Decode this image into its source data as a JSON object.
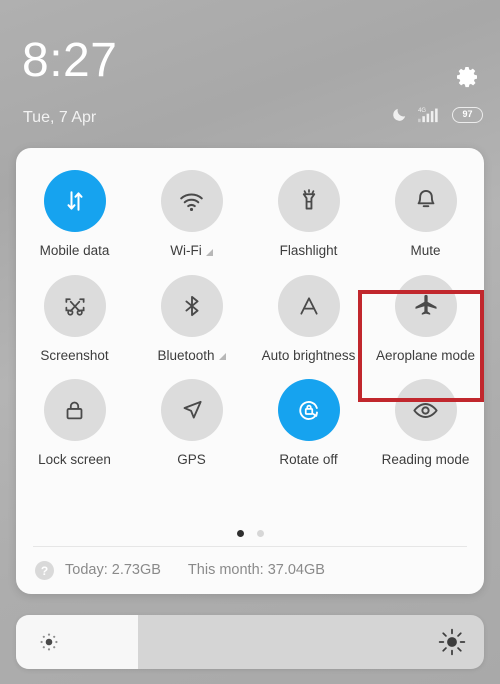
{
  "status_bar": {
    "time": "8:27",
    "date": "Tue, 7 Apr",
    "settings_icon": "gear-icon",
    "dnd_icon": "moon-icon",
    "network_type": "4G",
    "signal_icon": "signal-bars-icon",
    "battery_level": "97"
  },
  "quick_settings": {
    "tiles": [
      {
        "label": "Mobile data",
        "icon": "data-transfer-icon",
        "active": true,
        "expandable": false
      },
      {
        "label": "Wi-Fi",
        "icon": "wifi-icon",
        "active": false,
        "expandable": true
      },
      {
        "label": "Flashlight",
        "icon": "flashlight-icon",
        "active": false,
        "expandable": false
      },
      {
        "label": "Mute",
        "icon": "bell-icon",
        "active": false,
        "expandable": false
      },
      {
        "label": "Screenshot",
        "icon": "scissors-icon",
        "active": false,
        "expandable": false
      },
      {
        "label": "Bluetooth",
        "icon": "bluetooth-icon",
        "active": false,
        "expandable": true
      },
      {
        "label": "Auto brightness",
        "icon": "letter-a-icon",
        "active": false,
        "expandable": false
      },
      {
        "label": "Aeroplane mode",
        "icon": "airplane-icon",
        "active": false,
        "expandable": false
      },
      {
        "label": "Lock screen",
        "icon": "padlock-icon",
        "active": false,
        "expandable": false
      },
      {
        "label": "GPS",
        "icon": "navigation-arrow-icon",
        "active": false,
        "expandable": false
      },
      {
        "label": "Rotate off",
        "icon": "rotation-lock-icon",
        "active": true,
        "expandable": false
      },
      {
        "label": "Reading mode",
        "icon": "eye-icon",
        "active": false,
        "expandable": false
      }
    ],
    "pages": {
      "count": 2,
      "active_index": 0
    }
  },
  "highlight": {
    "target_label": "Aeroplane mode",
    "color": "#c1272d"
  },
  "data_usage": {
    "help_icon": "question-mark-icon",
    "help_glyph": "?",
    "today": "Today: 2.73GB",
    "this_month": "This month: 37.04GB"
  },
  "brightness": {
    "low_icon": "brightness-low-icon",
    "high_icon": "brightness-high-icon",
    "percent": 26
  },
  "colors": {
    "accent_blue": "#16a3ef",
    "tile_off": "#dcdcdc",
    "panel_bg": "#fbfbfb",
    "highlight_red": "#c1272d"
  }
}
